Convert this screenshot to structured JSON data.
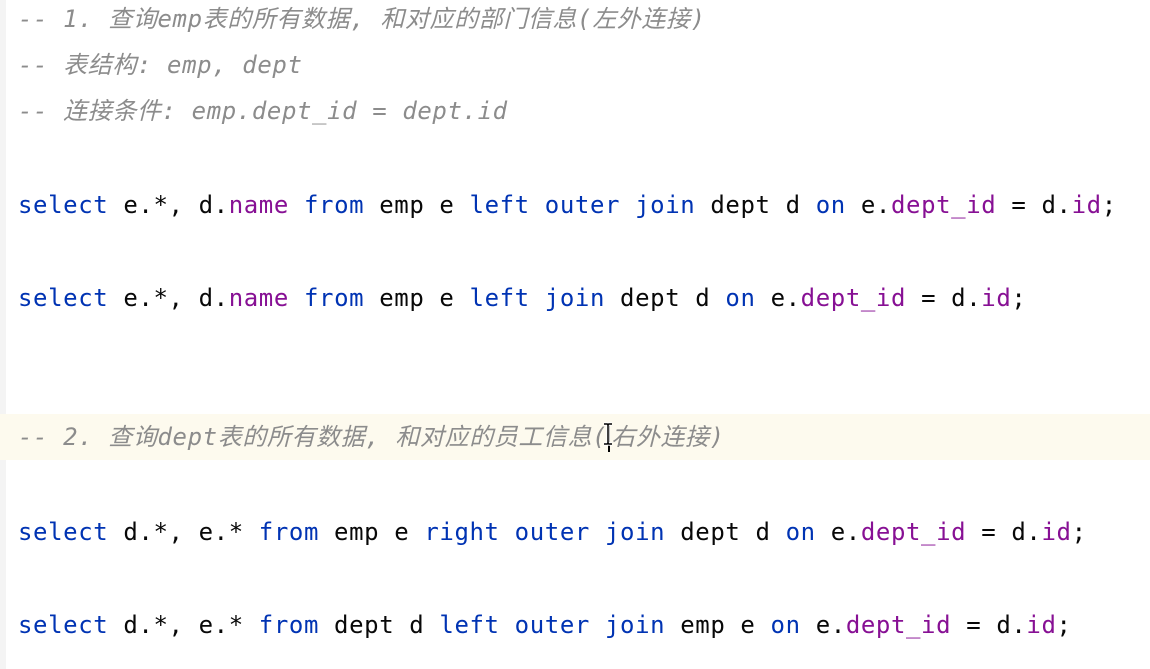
{
  "editor": {
    "colors": {
      "background": "#ffffff",
      "comment": "#8c8c8c",
      "keyword": "#0033b3",
      "field": "#871094",
      "plain": "#080808",
      "current_line": "#fdfaee"
    },
    "lines": {
      "c1": "-- 1. 查询emp表的所有数据, 和对应的部门信息(左外连接)",
      "c2": "-- 表结构: emp, dept",
      "c3": "-- 连接条件: emp.dept_id = dept.id",
      "q1": {
        "t1": "select",
        "t2": " e.*, d.",
        "t3": "name",
        "t4": " ",
        "t5": "from",
        "t6": " emp e ",
        "t7": "left",
        "t8": " ",
        "t9": "outer",
        "t10": " ",
        "t11": "join",
        "t12": " dept d ",
        "t13": "on",
        "t14": " e.",
        "t15": "dept_id",
        "t16": " = d.",
        "t17": "id",
        "t18": ";"
      },
      "q2": {
        "t1": "select",
        "t2": " e.*, d.",
        "t3": "name",
        "t4": " ",
        "t5": "from",
        "t6": " emp e ",
        "t7": "left",
        "t8": " ",
        "t9": "join",
        "t10": " dept d ",
        "t11": "on",
        "t12": " e.",
        "t13": "dept_id",
        "t14": " = d.",
        "t15": "id",
        "t16": ";"
      },
      "c4_before_caret": "-- 2. 查询dept表的所有数据, 和对应的员工信息(",
      "c4_after_caret": "右外连接)",
      "q3": {
        "t1": "select",
        "t2": " d.*, e.* ",
        "t3": "from",
        "t4": " emp e ",
        "t5": "right",
        "t6": " ",
        "t7": "outer",
        "t8": " ",
        "t9": "join",
        "t10": " dept d ",
        "t11": "on",
        "t12": " e.",
        "t13": "dept_id",
        "t14": " = d.",
        "t15": "id",
        "t16": ";"
      },
      "q4": {
        "t1": "select",
        "t2": " d.*, e.* ",
        "t3": "from",
        "t4": " dept d ",
        "t5": "left",
        "t6": " ",
        "t7": "outer",
        "t8": " ",
        "t9": "join",
        "t10": " emp e ",
        "t11": "on",
        "t12": " e.",
        "t13": "dept_id",
        "t14": " = d.",
        "t15": "id",
        "t16": ";"
      }
    },
    "mouse_cursor_icon": "text-ibeam-icon"
  }
}
